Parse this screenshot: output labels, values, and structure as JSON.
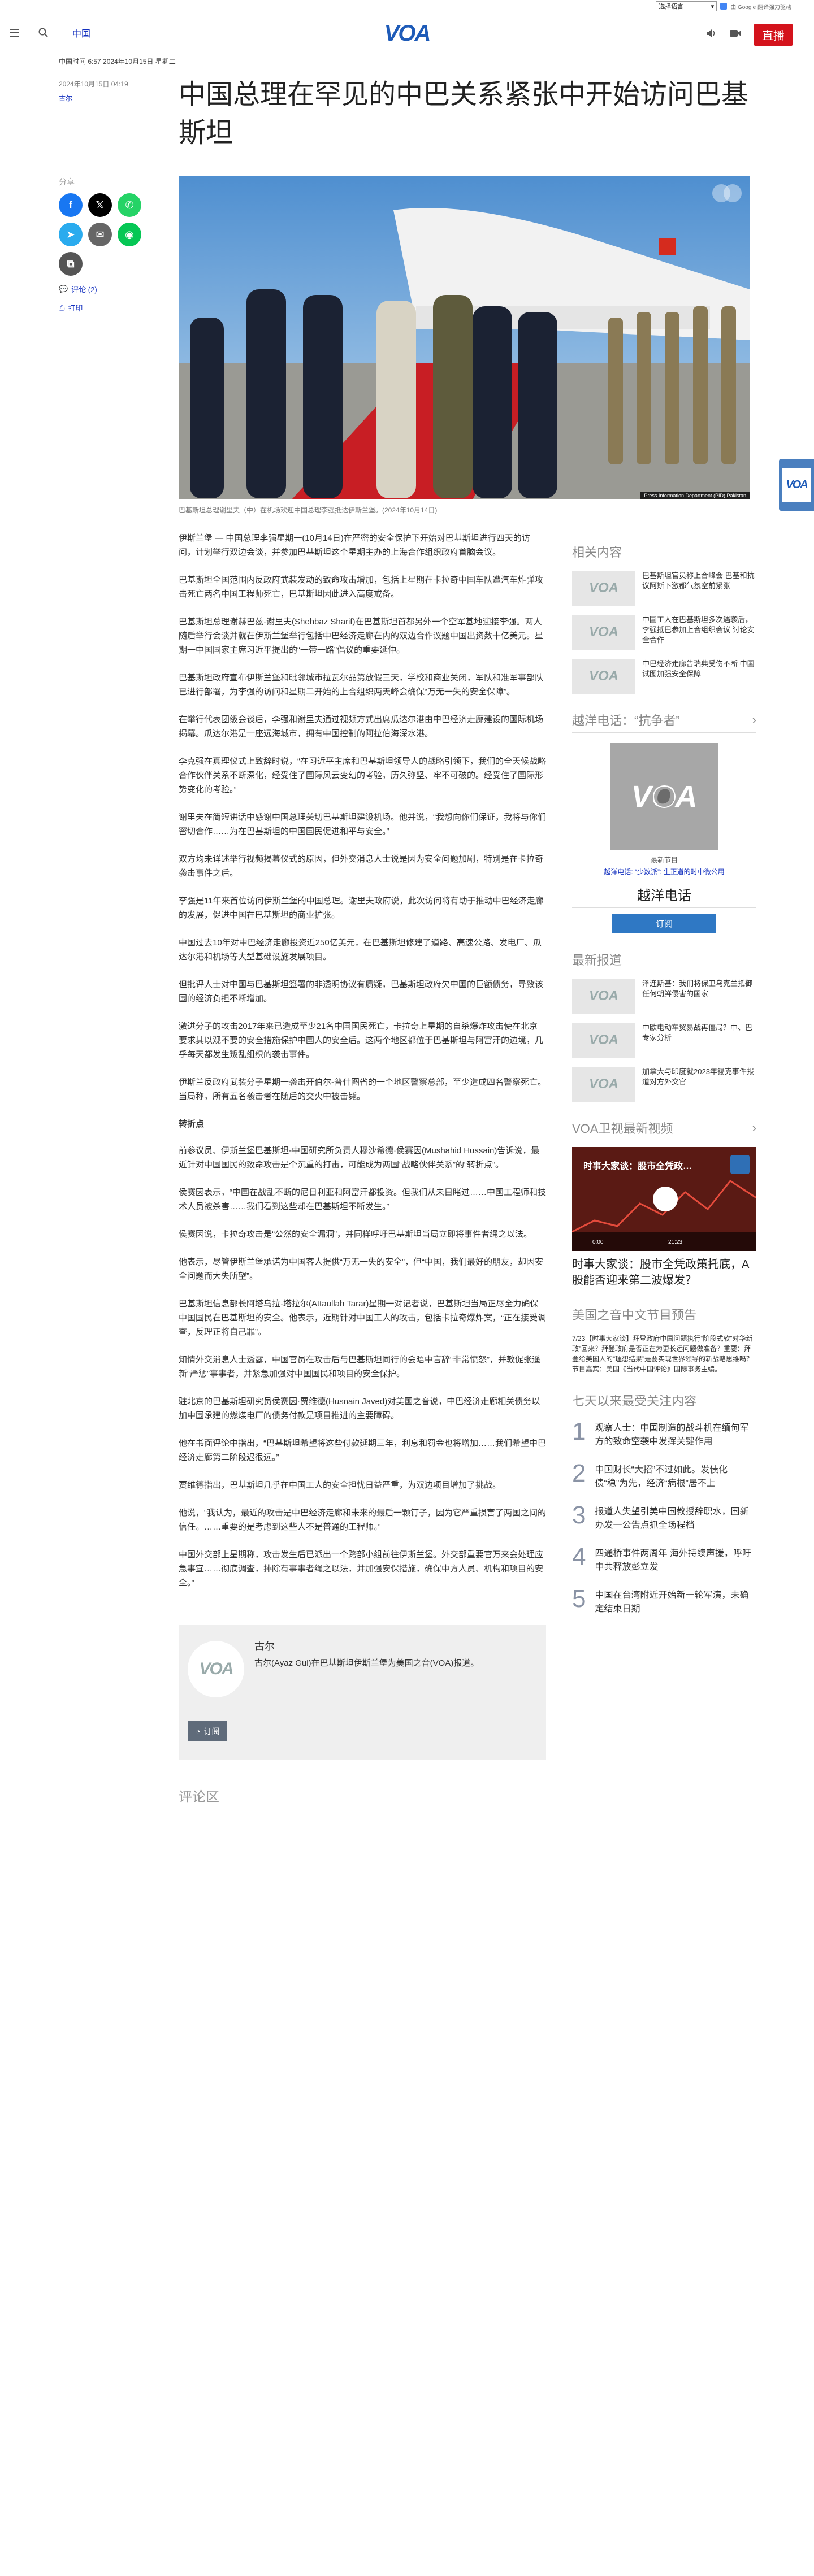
{
  "translate": {
    "select_label": "选择语言",
    "powered": "由 Google 翻译强力驱动"
  },
  "header": {
    "nav_label": "中国",
    "logo": "VOA",
    "live_label": "直播"
  },
  "dateline": "中国时间 6:57 2024年10月15日 星期二",
  "article": {
    "date": "2024年10月15日 04:19",
    "author": "古尔",
    "title": "中国总理在罕见的中巴关系紧张中开始访问巴基斯坦",
    "caption": "巴基斯坦总理谢里夫（中）在机场欢迎中国总理李强抵达伊斯兰堡。(2024年10月14日)",
    "photo_credit": "Press Information Department (PID) Pakistan"
  },
  "share": {
    "label": "分享",
    "comments": "评论 (2)",
    "print": "打印"
  },
  "body": {
    "p1": "伊斯兰堡 — 中国总理李强星期一(10月14日)在严密的安全保护下开始对巴基斯坦进行四天的访问，计划举行双边会谈，并参加巴基斯坦这个星期主办的上海合作组织政府首脑会议。",
    "p2": "巴基斯坦全国范围内反政府武装发动的致命攻击增加，包括上星期在卡拉奇中国车队遭汽车炸弹攻击死亡两名中国工程师死亡，巴基斯坦因此进入高度戒备。",
    "p3": "巴基斯坦总理谢赫巴兹·谢里夫(Shehbaz Sharif)在巴基斯坦首都另外一个空军基地迎接李强。两人随后举行会谈并就在伊斯兰堡举行包括中巴经济走廊在内的双边合作议题中国出资数十亿美元。星期一中国国家主席习近平提出的“一带一路”倡议的重要延伸。",
    "p4": "巴基斯坦政府宣布伊斯兰堡和毗邻城市拉瓦尔品第放假三天，学校和商业关闭，军队和准军事部队已进行部署，为李强的访问和星期二开始的上合组织两天峰会确保“万无一失的安全保障”。",
    "p5": "在举行代表团级会谈后，李强和谢里夫通过视频方式出席瓜达尔港由中巴经济走廊建设的国际机场揭幕。瓜达尔港是一座远海城市，拥有中国控制的阿拉伯海深水港。",
    "p6": "李克强在真理仪式上致辞时说，“在习近平主席和巴基斯坦领导人的战略引领下，我们的全天候战略合作伙伴关系不断深化，经受住了国际风云变幻的考验，历久弥坚、牢不可破的。经受住了国际形势变化的考验。”",
    "p7": "谢里夫在简短讲话中感谢中国总理关切巴基斯坦建设机场。他并说，“我想向你们保证，我将与你们密切合作……为在巴基斯坦的中国国民促进和平与安全。”",
    "p8": "双方均未详述举行视频揭幕仪式的原因，但外交消息人士说是因为安全问题加剧，特别是在卡拉奇袭击事件之后。",
    "p9": "李强是11年来首位访问伊斯兰堡的中国总理。谢里夫政府说，此次访问将有助于推动中巴经济走廊的发展，促进中国在巴基斯坦的商业扩张。",
    "p10": "中国过去10年对中巴经济走廊投资近250亿美元，在巴基斯坦修建了道路、高速公路、发电厂、瓜达尔港和机场等大型基础设施发展项目。",
    "p11": "但批评人士对中国与巴基斯坦签署的非透明协议有质疑，巴基斯坦政府欠中国的巨额债务，导致该国的经济负担不断增加。",
    "p12": "激进分子的攻击2017年来已造成至少21名中国国民死亡，卡拉奇上星期的自杀爆炸攻击使在北京要求其以观不要的安全措施保护中国人的安全后。这两个地区都位于巴基斯坦与阿富汗的边境，几乎每天都发生叛乱组织的袭击事件。",
    "p13": "伊斯兰反政府武装分子星期一袭击开伯尔-普什图省的一个地区警察总部，至少造成四名警察死亡。当局称，所有五名袭击者在随后的交火中被击毙。",
    "h_risk": "转折点",
    "p14": "前参议员、伊斯兰堡巴基斯坦-中国研究所负责人穆沙希德·侯赛因(Mushahid Hussain)告诉说，最近针对中国国民的致命攻击是个沉重的打击，可能成为两国“战略伙伴关系”的“转折点”。",
    "p15": "侯赛因表示，“中国在战乱不断的尼日利亚和阿富汗都投资。但我们从未目睹过……中国工程师和技术人员被杀害……我们看到这些却在巴基斯坦不断发生。”",
    "p16": "侯赛因说，卡拉奇攻击是“公然的安全漏洞”，并同样呼吁巴基斯坦当局立即将事件者绳之以法。",
    "p17": "他表示，尽管伊斯兰堡承诺为中国客人提供“万无一失的安全”，但“中国，我们最好的朋友，却因安全问题而大失所望”。",
    "p18": "巴基斯坦信息部长阿塔乌拉·塔拉尔(Attaullah Tarar)星期一对记者说，巴基斯坦当局正尽全力确保中国国民在巴基斯坦的安全。他表示，近期针对中国工人的攻击，包括卡拉奇爆炸案，“正在接受调查，反理正将自己罪”。",
    "p19": "知情外交消息人士透露，中国官员在攻击后与巴基斯坦同行的会晤中言辞“非常愤怒”，并敦促张遥新“严惩”事事者，并紧急加强对中国国民和项目的安全保护。",
    "p20": "驻北京的巴基斯坦研究员侯赛因·贾维德(Husnain Javed)对美国之音说，中巴经济走廊相关债务以加中国承建的燃煤电厂的债务付款是项目推进的主要障碍。",
    "p21": "他在书面评论中指出，“巴基斯坦希望将这些付款延期三年，利息和罚金也将增加……我们希望中巴经济走廊第二阶段迟很远。”",
    "p22": "贾维德指出，巴基斯坦几乎在中国工人的安全担忧日益严重，为双边项目增加了挑战。",
    "p23": "他说，“我认为，最近的攻击是中巴经济走廊和未来的最后一颗钉子，因为它严重损害了两国之间的信任。……重要的是考虑到这些人不是普通的工程师。”",
    "p24": "中国外交部上星期称，攻击发生后已派出一个跨部小组前往伊斯兰堡。外交部重要官万来会处理应急事宜……彻底调查，排除有事事者绳之以法，并加强安保措施，确保中方人员、机构和项目的安全。”"
  },
  "author_card": {
    "name": "古尔",
    "bio": "古尔(Ayaz Gul)在巴基斯坦伊斯兰堡为美国之音(VOA)报道。",
    "subscribe": "订阅"
  },
  "comments_title": "评论区",
  "sidebar": {
    "related_title": "相关内容",
    "related": [
      "巴基斯坦官员称上合峰会 巴基和抗议阿斯下激都气氛空前紧张",
      "中国工人在巴基斯坦多次遇袭后，李强抵巴参加上合组织会议 讨论安全合作",
      "中巴经济走廊告瑞典受伤不断 中国试图加强安全保障"
    ],
    "podcast_title": "越洋电话：“抗争者”",
    "podcast_label": "最新节目",
    "podcast_sub": "越洋电话: “少数派”: 生正道的时中微公用",
    "podcast_name": "越洋电话",
    "podcast_btn": "订阅",
    "latest_title": "最新报道",
    "latest": [
      "泽连斯基：我们将保卫乌克兰抵御任何朝鲜侵害的国家",
      "中欧电动车贸易战再僵局？中、巴专家分析",
      "加拿大与印度就2023年锡克事件报道对方外交官"
    ],
    "video_title": "VOA卫视最新视频",
    "video_overlay": "时事大家谈：股市全凭政…",
    "video_time": "0:00",
    "video_duration": "21:23",
    "video_caption": "时事大家谈：股市全凭政策托底，A股能否迎来第二波爆发？",
    "prog_title": "美国之音中文节目预告",
    "prog_text": "7/23【时事大家谈】拜登政府中国问题执行“阶段式软”对华新政”回来？拜登政府是否正在为更长远问题做准备？重要：拜登给美国人的“理想结果”是要实现世界领导的新战略思维吗？节目嘉宾：美国《当代中国评论》国际事务主编。",
    "rank_title": "七天以来最受关注内容",
    "rank": [
      "观察人士：中国制造的战斗机在缅甸军方的致命空袭中发挥关键作用",
      "中国财长“大招”不过如此。发债化债“稳”为先，经济“病根”居不上",
      "报道人失望引美中国教授辞职水，国新办发一公告点抓全场程档",
      "四通桥事件两周年 海外持续声援，呼吁中共释放彭立发",
      "中国在台湾附近开始新一轮军演，未确定结束日期"
    ]
  }
}
